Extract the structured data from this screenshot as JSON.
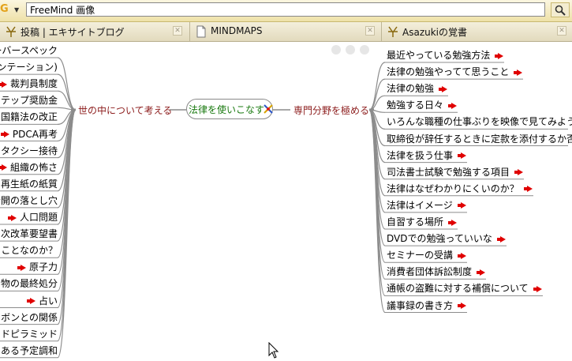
{
  "search": {
    "engine_letter": "G",
    "value": "FreeMind 画像"
  },
  "tabs": [
    {
      "label": "投稿 | エキサイトブログ",
      "icon": "star-pen-icon"
    },
    {
      "label": "MINDMAPS",
      "icon": "page-icon"
    },
    {
      "label": "Asazukiの覚書",
      "icon": "star-pen-icon"
    }
  ],
  "mindmap": {
    "root": "法律を使いこなす",
    "left_branch": "世の中について考える",
    "right_branch": "専門分野を極める",
    "left_children": [
      {
        "label": "ーバースペック",
        "link": false
      },
      {
        "label": "ゼンテーション)",
        "link": false
      },
      {
        "label": "裁判員制度",
        "link": true
      },
      {
        "label": "ステップ奨励金",
        "link": false
      },
      {
        "label": "国籍法の改正",
        "link": false
      },
      {
        "label": "PDCA再考",
        "link": true
      },
      {
        "label": "タクシー接待",
        "link": true
      },
      {
        "label": "組織の怖さ",
        "link": true
      },
      {
        "label": "再生紙の紙質",
        "link": false
      },
      {
        "label": "公開の落とし穴",
        "link": false
      },
      {
        "label": "人口問題",
        "link": true
      },
      {
        "label": "次改革要望書",
        "link": false
      },
      {
        "label": "ことなのか？",
        "link": false
      },
      {
        "label": "原子力",
        "link": true
      },
      {
        "label": "物の最終処分",
        "link": false
      },
      {
        "label": "占い",
        "link": true
      },
      {
        "label": "ラボンとの関係",
        "link": false
      },
      {
        "label": "フードピラミッド",
        "link": false
      },
      {
        "label": "ある予定調和",
        "link": false
      }
    ],
    "right_children": [
      {
        "label": "最近やっている勉強方法",
        "link": true
      },
      {
        "label": "法律の勉強やってて思うこと",
        "link": true
      },
      {
        "label": "法律の勉強",
        "link": true
      },
      {
        "label": "勉強する日々",
        "link": true
      },
      {
        "label": "いろんな職種の仕事ぶりを映像で見てみよう！",
        "link": false
      },
      {
        "label": "取締役が辞任するときに定款を添付するか否か",
        "link": false
      },
      {
        "label": "法律を扱う仕事",
        "link": true
      },
      {
        "label": "司法書士試験で勉強する項目",
        "link": true
      },
      {
        "label": "法律はなぜわかりにくいのか？",
        "link": true
      },
      {
        "label": "法律はイメージ",
        "link": true
      },
      {
        "label": "自習する場所",
        "link": true
      },
      {
        "label": "DVDでの勉強っていいな",
        "link": true
      },
      {
        "label": "セミナーの受講",
        "link": true
      },
      {
        "label": "消費者団体訴訟制度",
        "link": true
      },
      {
        "label": "通帳の盗難に対する補償について",
        "link": true
      },
      {
        "label": "議事録の書き方",
        "link": true
      }
    ]
  },
  "colors": {
    "root_text": "#1a7a10",
    "branch_text": "#8b1a1a",
    "link_arrow": "#e00000",
    "edge": "#8c8c8c"
  }
}
